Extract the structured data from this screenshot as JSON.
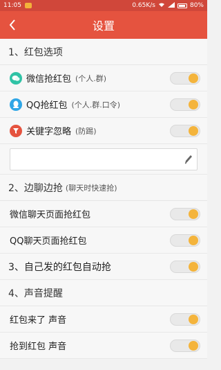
{
  "status_bar": {
    "time": "11:05",
    "speed": "0.65K/s",
    "battery": "80%"
  },
  "header": {
    "title": "设置"
  },
  "sections": {
    "s1": {
      "title": "1、红包选项"
    },
    "s2": {
      "title": "2、边聊边抢",
      "hint": "(聊天时快速抢)"
    },
    "s3": {
      "title": "3、自己发的红包自动抢"
    },
    "s4": {
      "title": "4、声音提醒"
    }
  },
  "rows": {
    "wechat": {
      "label": "微信抢红包",
      "hint": "(个人.群)",
      "on": true
    },
    "qq": {
      "label": "QQ抢红包",
      "hint": "(个人.群.口令)",
      "on": true
    },
    "keyword": {
      "label": "关键字忽略",
      "hint": "(防踢)",
      "on": true,
      "input_value": ""
    },
    "wechat_chat": {
      "label": "微信聊天页面抢红包",
      "on": true
    },
    "qq_chat": {
      "label": "QQ聊天页面抢红包",
      "on": true
    },
    "self_auto": {
      "on": true
    },
    "sound_arrive": {
      "label": "红包来了 声音",
      "on": true
    },
    "sound_grab": {
      "label": "抢到红包 声音",
      "on": true
    }
  },
  "colors": {
    "accent": "#e5533f",
    "toggle_knob": "#f4b43c",
    "wechat": "#30c3a6",
    "qq": "#2fa6e6",
    "keyword": "#e5533f"
  },
  "icons": [
    "back-arrow-icon",
    "wechat-icon",
    "qq-icon",
    "filter-icon",
    "pencil-icon"
  ]
}
